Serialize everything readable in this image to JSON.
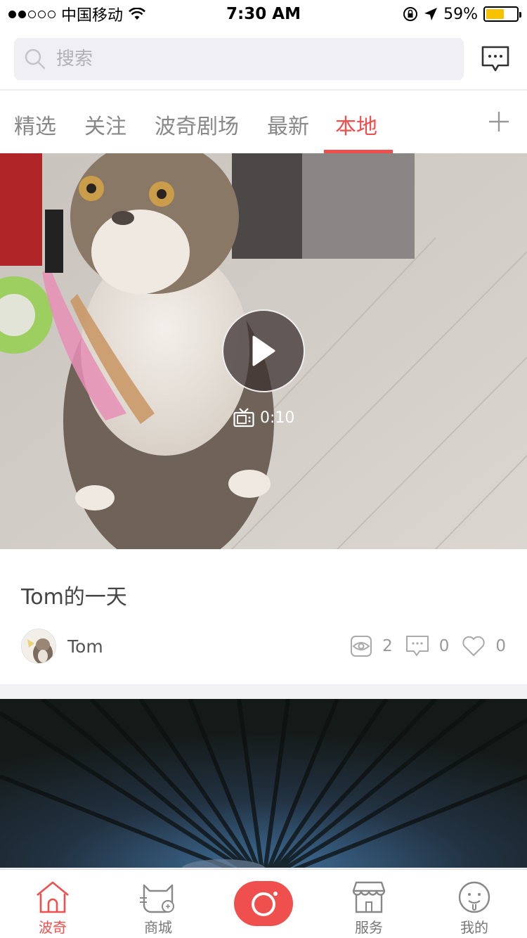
{
  "status_bar": {
    "carrier": "中国移动",
    "time": "7:30 AM",
    "battery": "59%",
    "battery_level": 0.59
  },
  "search": {
    "placeholder": "搜索"
  },
  "tabs": [
    {
      "label": "精选"
    },
    {
      "label": "关注"
    },
    {
      "label": "波奇剧场"
    },
    {
      "label": "最新"
    },
    {
      "label": "本地"
    }
  ],
  "active_tab": "本地",
  "feed": [
    {
      "duration": "0:10",
      "title": "Tom的一天",
      "author": "Tom",
      "views": "2",
      "comments": "0",
      "likes": "0"
    }
  ],
  "tabbar": {
    "items": [
      {
        "label": "波奇",
        "icon": "home-icon"
      },
      {
        "label": "商城",
        "icon": "shop-cat-icon"
      },
      {
        "label": "",
        "icon": "camera-icon"
      },
      {
        "label": "服务",
        "icon": "store-icon"
      },
      {
        "label": "我的",
        "icon": "profile-icon"
      }
    ]
  },
  "colors": {
    "accent": "#f0504d",
    "battery": "#f7c200"
  }
}
